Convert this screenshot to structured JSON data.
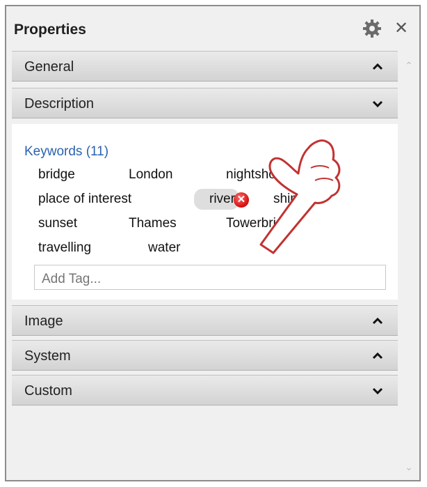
{
  "panel": {
    "title": "Properties",
    "icons": {
      "settings": "gear-icon",
      "close": "close-icon",
      "close_glyph": "✕"
    }
  },
  "sections": {
    "general": {
      "label": "General",
      "state": "collapsed"
    },
    "description": {
      "label": "Description",
      "state": "expanded"
    },
    "image": {
      "label": "Image",
      "state": "collapsed"
    },
    "system": {
      "label": "System",
      "state": "collapsed"
    },
    "custom": {
      "label": "Custom",
      "state": "expanded"
    }
  },
  "keywords": {
    "header": "Keywords (11)",
    "tags": [
      "bridge",
      "London",
      "nightshot",
      "place of interest",
      "river",
      "ship",
      "sunset",
      "Thames",
      "Towerbridge",
      "travelling",
      "water"
    ],
    "hovered_tag": "river",
    "add_placeholder": "Add Tag..."
  },
  "colors": {
    "accent": "#2a62ae",
    "remove_button": "#d10d0d",
    "header_bg": "#dcdcdc"
  }
}
